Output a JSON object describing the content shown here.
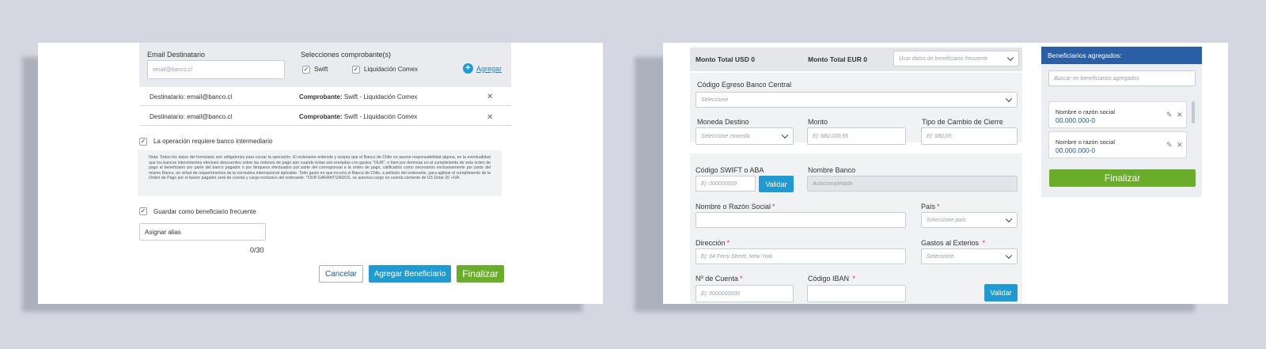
{
  "left": {
    "email_label": "Email Destinatario",
    "email_placeholder": "email@banco.cl",
    "comprobante_label": "Selecciones comprobante(s)",
    "swift_label": "Swift",
    "liquidacion_label": "Liquidación Comex",
    "agregar_label": "Agregar",
    "recipients": [
      {
        "dest_label": "Destinatario:",
        "dest_value": "email@banco.cl",
        "comp_label": "Comprobante:",
        "comp_value": "Swift - Liquidación Comex"
      },
      {
        "dest_label": "Destinatario:",
        "dest_value": "email@banco.cl",
        "comp_label": "Comprobante:",
        "comp_value": "Swift - Liquidación Comex"
      }
    ],
    "intermediario_label": "La operación requiere banco intermediario",
    "nota_text": "Nota: Todos los datos del formulario son obligatorios para cursar la operación. El ordenante entiende y acepta que el Banco de Chile no asume responsabilidad alguna, en la eventualidad que los bancos intervinientes efectuen descuentos sobre las órdenes de pago aún cuando éstas son enviadas con gastos \"OUR\", o bien por demoras en el cumplimiento de esta orden de pago al beneficiario por parte del banco pagador o por bloqueos efectuados por parte del corresponsal a la orden de pago, calificados como necesarios exclusivamente por parte del mismo Banco, en virtud de requerimientos de la normativa internacional aplicable. Todo gasto en que incurra el Banco de Chile, a petición del ordenante, para agilizar el cumplimiento de la Orden de Pago por el banco pagador será de cuenta y cargo exclusivo del ordenante. *OUR GARANTIZADOS, se autoriza cargo en cuenta corriente de US Dolar 20 +IVA.",
    "guardar_label": "Guardar como beneficiario frecuente",
    "alias_placeholder": "Asignar alias",
    "alias_counter": "0/30",
    "cancel_label": "Cancelar",
    "agregar_benef_label": "Agregar Beneficiario",
    "finalizar_label": "Finalizar"
  },
  "right": {
    "monto_usd": "Monto Total USD 0",
    "monto_eur": "Monto Total EUR 0",
    "frecuente_placeholder": "Usar datos de beneficiario frecuente",
    "codigo_egreso_label": "Código Egreso Banco Central",
    "codigo_egreso_placeholder": "Seleccione",
    "moneda_label": "Moneda Destino",
    "moneda_placeholder": "Seleccione moneda",
    "monto_label": "Monto",
    "monto_placeholder": "Ej: 680.000,65",
    "tipo_cambio_label": "Tipo de Cambio de Cierre",
    "tipo_cambio_placeholder": "Ej: 680,65",
    "swift_label": "Código SWIFT o ABA",
    "swift_placeholder": "Ej: 000000009",
    "validar_label": "Validar",
    "nombre_banco_label": "Nombre Banco",
    "nombre_banco_placeholder": "Autocompletado",
    "razon_social_label": "Nombre o Razón Social",
    "pais_label": "País",
    "pais_placeholder": "Seleccione país",
    "direccion_label": "Dirección",
    "direccion_placeholder": "Ej: 64 Ferry Street, New York",
    "gastos_label": "Gastos al Exterios",
    "gastos_placeholder": "Seleccione",
    "cuenta_label": "Nº de Cuenta",
    "cuenta_placeholder": "Ej: 0000000000",
    "iban_label": "Código IBAN",
    "validar2_label": "Validar",
    "beneficiarios_title": "Beneficiarios agregados:",
    "buscar_placeholder": "Buscar en beneficiarios agregados",
    "beneficiarios": [
      {
        "name": "Nombre o razón social",
        "rut": "00.000.000-0"
      },
      {
        "name": "Nombre o razón social",
        "rut": "00.000.000-0"
      }
    ],
    "finalizar_label": "Finalizar"
  },
  "colors": {
    "background": "#d4d7e2",
    "accent_blue": "#1f9ad3",
    "accent_green": "#6aad2a",
    "header_blue": "#2a5fa6",
    "link_blue": "#1f5b8f"
  }
}
